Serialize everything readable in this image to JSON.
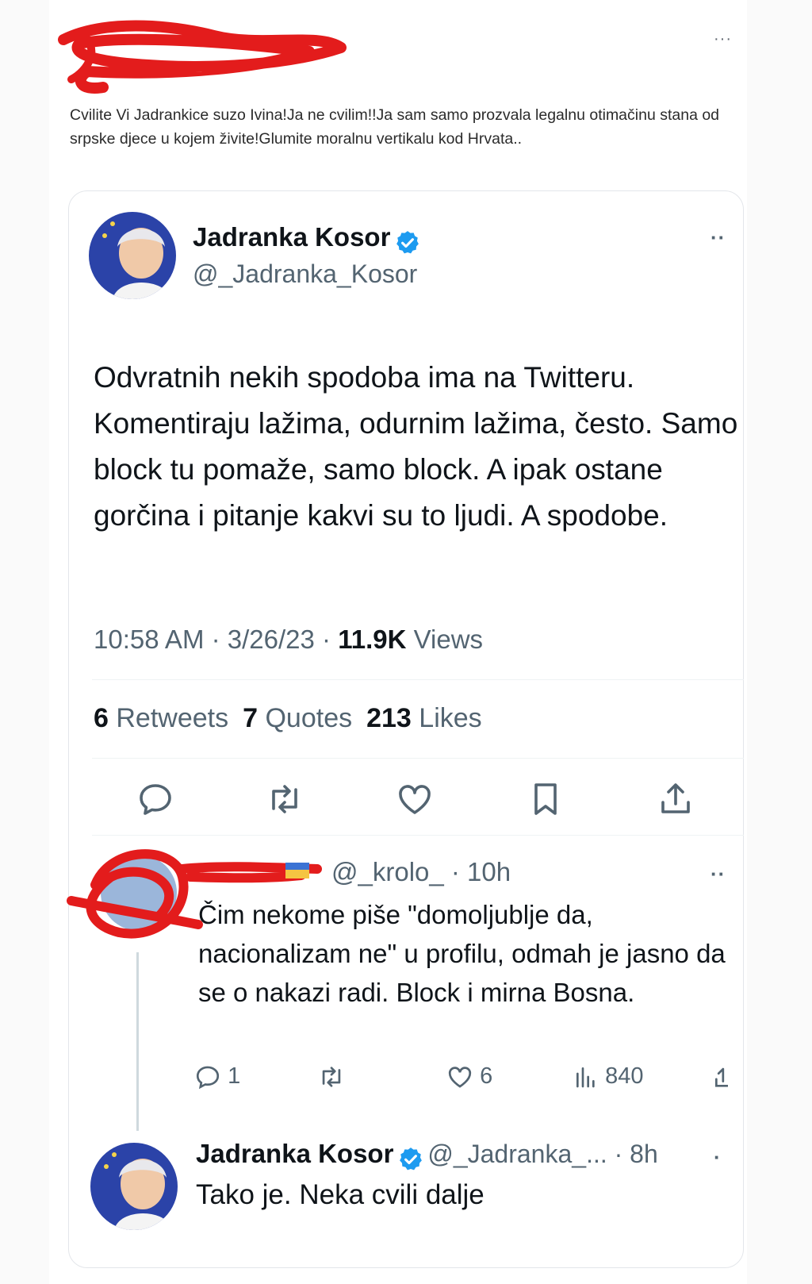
{
  "post": {
    "more_label": "···",
    "text": "Cvilite Vi Jadrankice suzo Ivina!Ja ne cvilim!!Ja sam samo prozvala legalnu otimačinu stana od srpske djece u kojem živite!Glumite moralnu vertikalu kod Hrvata.."
  },
  "tweet": {
    "author_name": "Jadranka Kosor",
    "author_handle": "@_Jadranka_Kosor",
    "more_label": "··",
    "body": "Odvratnih nekih spodoba ima na Twitteru. Komentiraju lažima, odurnim lažima, često. Samo block tu pomaže, samo block. A ipak ostane gorčina i pitanje kakvi su to ljudi. A spodobe.",
    "time": "10:58 AM · 3/26/23 · ",
    "views_count": "11.9K",
    "views_label": " Views",
    "retweets_count": "6",
    "retweets_label": " Retweets",
    "quotes_count": "7",
    "quotes_label": " Quotes",
    "likes_count": "213",
    "likes_label": " Likes",
    "actions": [
      "reply-icon",
      "retweet-icon",
      "like-icon",
      "bookmark-icon",
      "share-icon"
    ]
  },
  "reply": {
    "handle_time": "@_krolo_ · 10h",
    "more_label": "··",
    "body": "Čim nekome piše  \"domoljublje da, nacionalizam ne\" u profilu, odmah je jasno da se o nakazi radi. Block i mirna Bosna.",
    "reply_count": "1",
    "like_count": "6",
    "views_count": "840"
  },
  "last_reply": {
    "author_name": "Jadranka Kosor",
    "handle_time": "@_Jadranka_... · 8h",
    "more_label": "·",
    "body": "Tako je. Neka cvili dalje"
  },
  "colors": {
    "verified": "#1d9bf0",
    "scribble": "#e31c1c",
    "muted_text": "#536471"
  }
}
